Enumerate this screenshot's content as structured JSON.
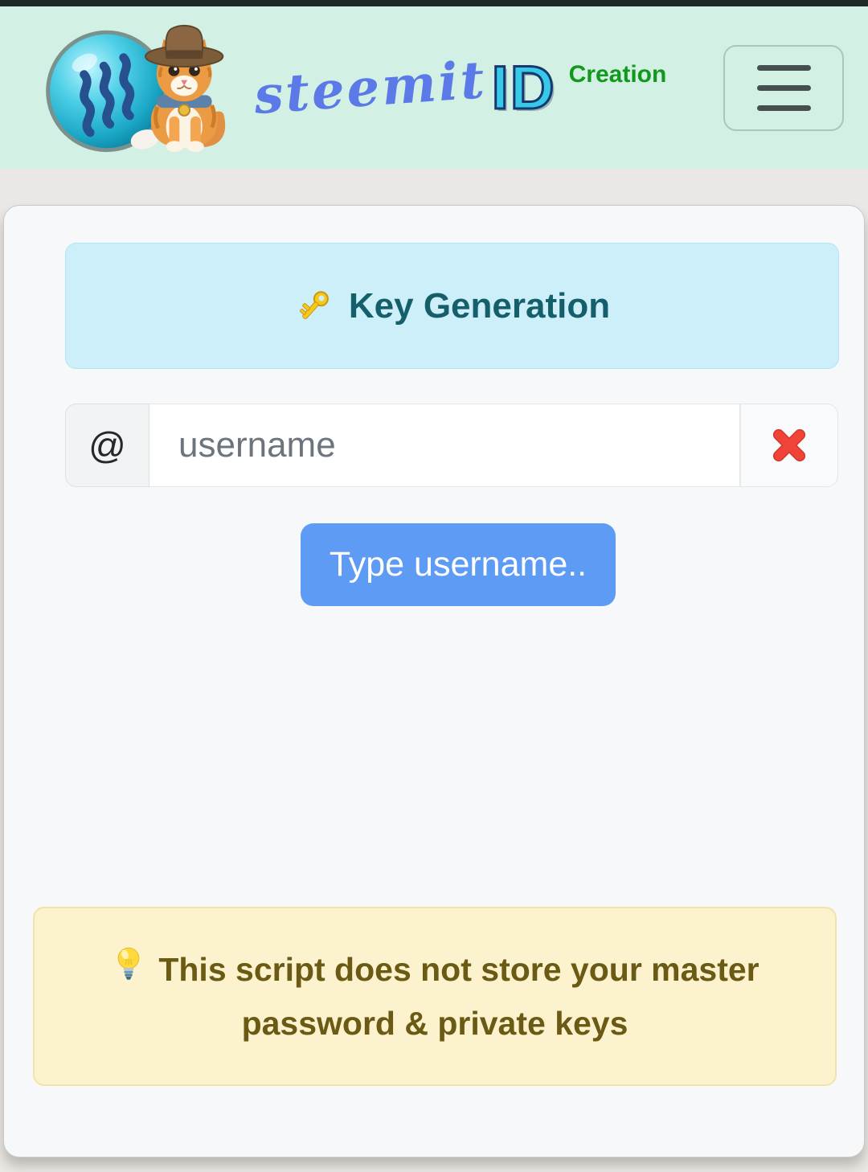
{
  "header": {
    "logo": "steemit-cat-cowboy-logo",
    "brand_script": "steemit",
    "brand_id": "ID",
    "brand_suffix": "Creation",
    "menu_icon": "hamburger-icon"
  },
  "panel": {
    "icon": "key-icon",
    "title": "Key Generation"
  },
  "form": {
    "username_prefix": "@",
    "username_placeholder": "username",
    "username_value": "",
    "clear_icon": "red-cross-icon",
    "submit_label": "Type username.."
  },
  "notice": {
    "icon": "light-bulb-icon",
    "text": "This script does not store your master password & private keys"
  },
  "colors": {
    "status_bar": "#1f2a26",
    "header_bg": "#d2f0e3",
    "page_bg": "#eae7e4",
    "card_bg": "#f6f8fa",
    "panel_bg": "#cdeffa",
    "panel_title_text": "#155f6b",
    "button_bg": "#5d9bf5",
    "button_text": "#ffffff",
    "notice_bg": "#fcf3ce",
    "notice_text": "#6b5a14",
    "clear_icon_red": "#ee3a2f",
    "brand_script_color": "#5b7ae8",
    "brand_id_color": "#39c9e8",
    "brand_suffix_color": "#12991d",
    "placeholder_color": "#6c757d"
  }
}
